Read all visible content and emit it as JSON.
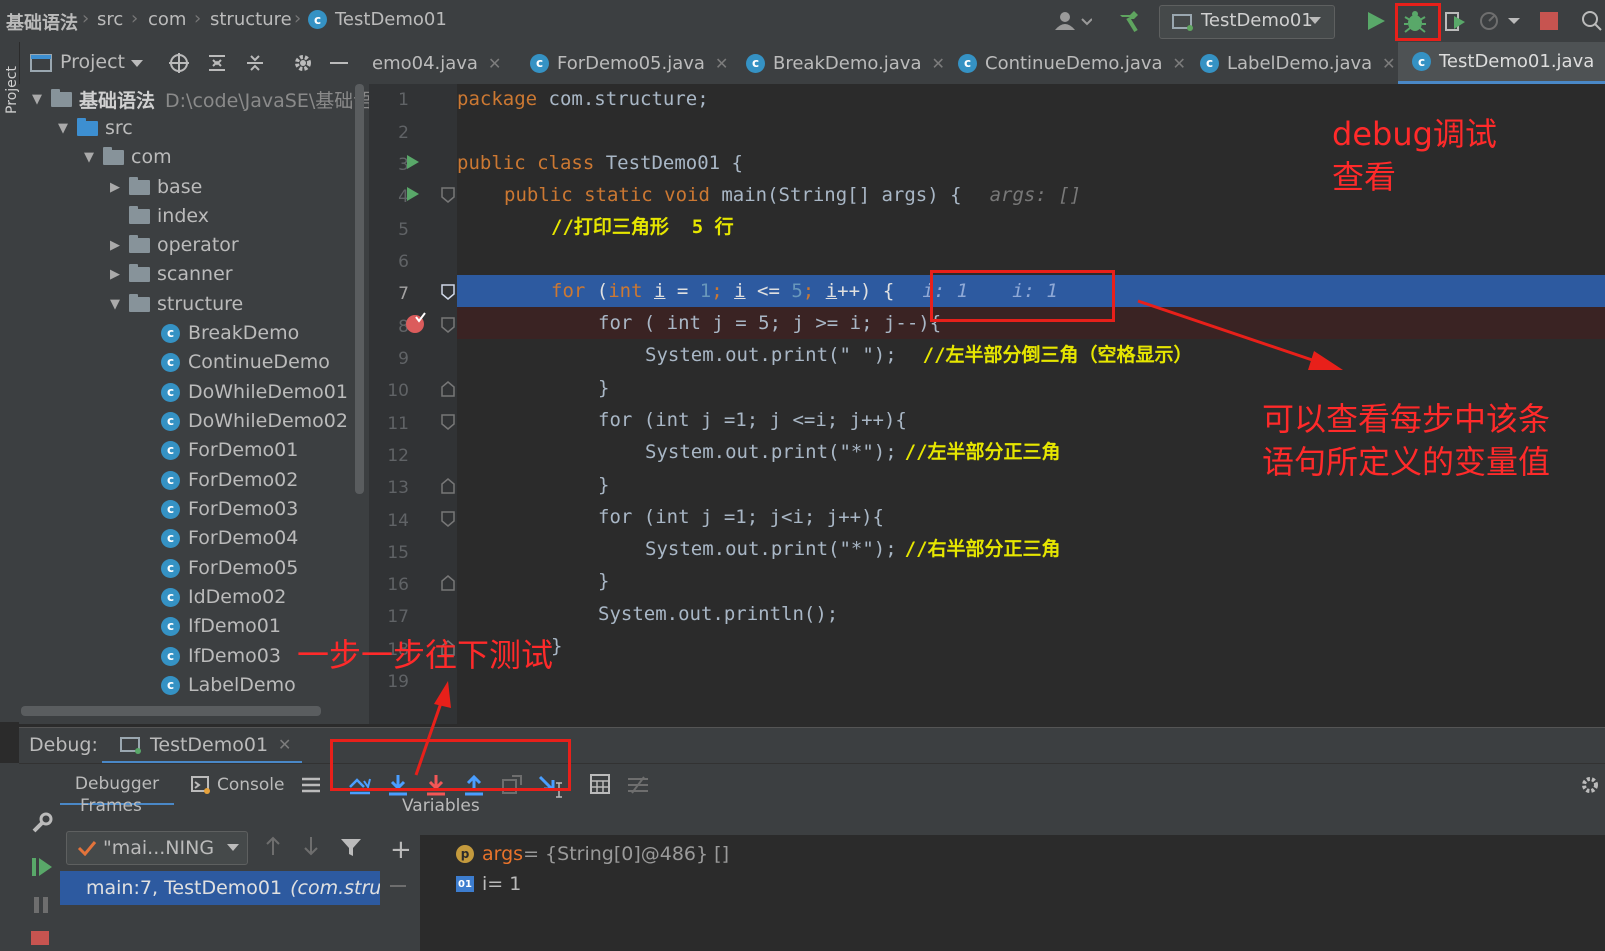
{
  "breadcrumb": [
    "基础语法",
    "src",
    "com",
    "structure",
    "TestDemo01"
  ],
  "run_config": "TestDemo01",
  "left_strip_label": "Project",
  "project_panel": {
    "title": "Project",
    "root_name": "基础语法",
    "root_path": "D:\\code\\JavaSE\\基础语法",
    "tree": [
      "src",
      "com",
      "base",
      "index",
      "operator",
      "scanner",
      "structure"
    ],
    "classes": [
      "BreakDemo",
      "ContinueDemo",
      "DoWhileDemo01",
      "DoWhileDemo02",
      "ForDemo01",
      "ForDemo02",
      "ForDemo03",
      "ForDemo04",
      "ForDemo05",
      "IdDemo02",
      "IfDemo01",
      "IfDemo03",
      "LabelDemo"
    ]
  },
  "tabs": [
    "emo04.java",
    "ForDemo05.java",
    "BreakDemo.java",
    "ContinueDemo.java",
    "LabelDemo.java",
    "TestDemo01.java"
  ],
  "line_numbers": [
    "1",
    "2",
    "3",
    "4",
    "5",
    "6",
    "7",
    "8",
    "9",
    "10",
    "11",
    "12",
    "13",
    "14",
    "15",
    "16",
    "17",
    "18",
    "19"
  ],
  "code": {
    "l1_kw": "package",
    "l1_rest": " com.structure;",
    "l3_kw": "public class",
    "l3_rest": " TestDemo01 {",
    "l4_kw": "public static void",
    "l4_rest": " main(String[] args) {",
    "l4_hint": "args: []",
    "l5_comment": "//打印三角形  5 行",
    "l7_for": "for",
    "l7_paren": " (",
    "l7_int": "int",
    "l7_i": "i",
    "l7_eq": " = ",
    "l7_one": "1",
    "l7_semi1": "; ",
    "l7_i2": "i",
    "l7_le": " <= ",
    "l7_five": "5",
    "l7_semi2": "; ",
    "l7_i3": "i",
    "l7_inc": "++) {",
    "l7_hint1": "i: 1",
    "l7_hint2": "i: 1",
    "l8_text": "for ( int j = 5; j >= i; j--){",
    "l9_text": "System.out.print(\" \");",
    "l9_comment": "//左半部分倒三角（空格显示）",
    "l10_text": "}",
    "l11_text": "for (int j =1; j <=i; j++){",
    "l12_text": "System.out.print(\"*\");",
    "l12_comment": "//左半部分正三角",
    "l13_text": "}",
    "l14_text": "for (int j =1; j<i; j++){",
    "l15_text": "System.out.print(\"*\");",
    "l15_comment": "//右半部分正三角",
    "l16_text": "}",
    "l17_text": "System.out.println();",
    "l18_text": "}"
  },
  "debug": {
    "label": "Debug:",
    "session": "TestDemo01",
    "tab_debugger": "Debugger",
    "tab_console": "Console",
    "frames_label": "Frames",
    "variables_label": "Variables",
    "thread": "\"mai...NING",
    "frame": "main:7, TestDemo01",
    "frame_pkg": "(com.structure)",
    "var1_name": "args",
    "var1_value": " = {String[0]@486} []",
    "var2_name": "i",
    "var2_value": " = 1"
  },
  "annotations": {
    "debug_line1": "debug调试",
    "debug_line2": "查看",
    "vars_line1": "可以查看每步中该条",
    "vars_line2": "语句所定义的变量值",
    "step": "一步一步往下测试"
  },
  "colors": {
    "annotation": "#ff2a2a",
    "execution_line": "#2d5aa0",
    "breakpoint_line": "#3a2323"
  }
}
